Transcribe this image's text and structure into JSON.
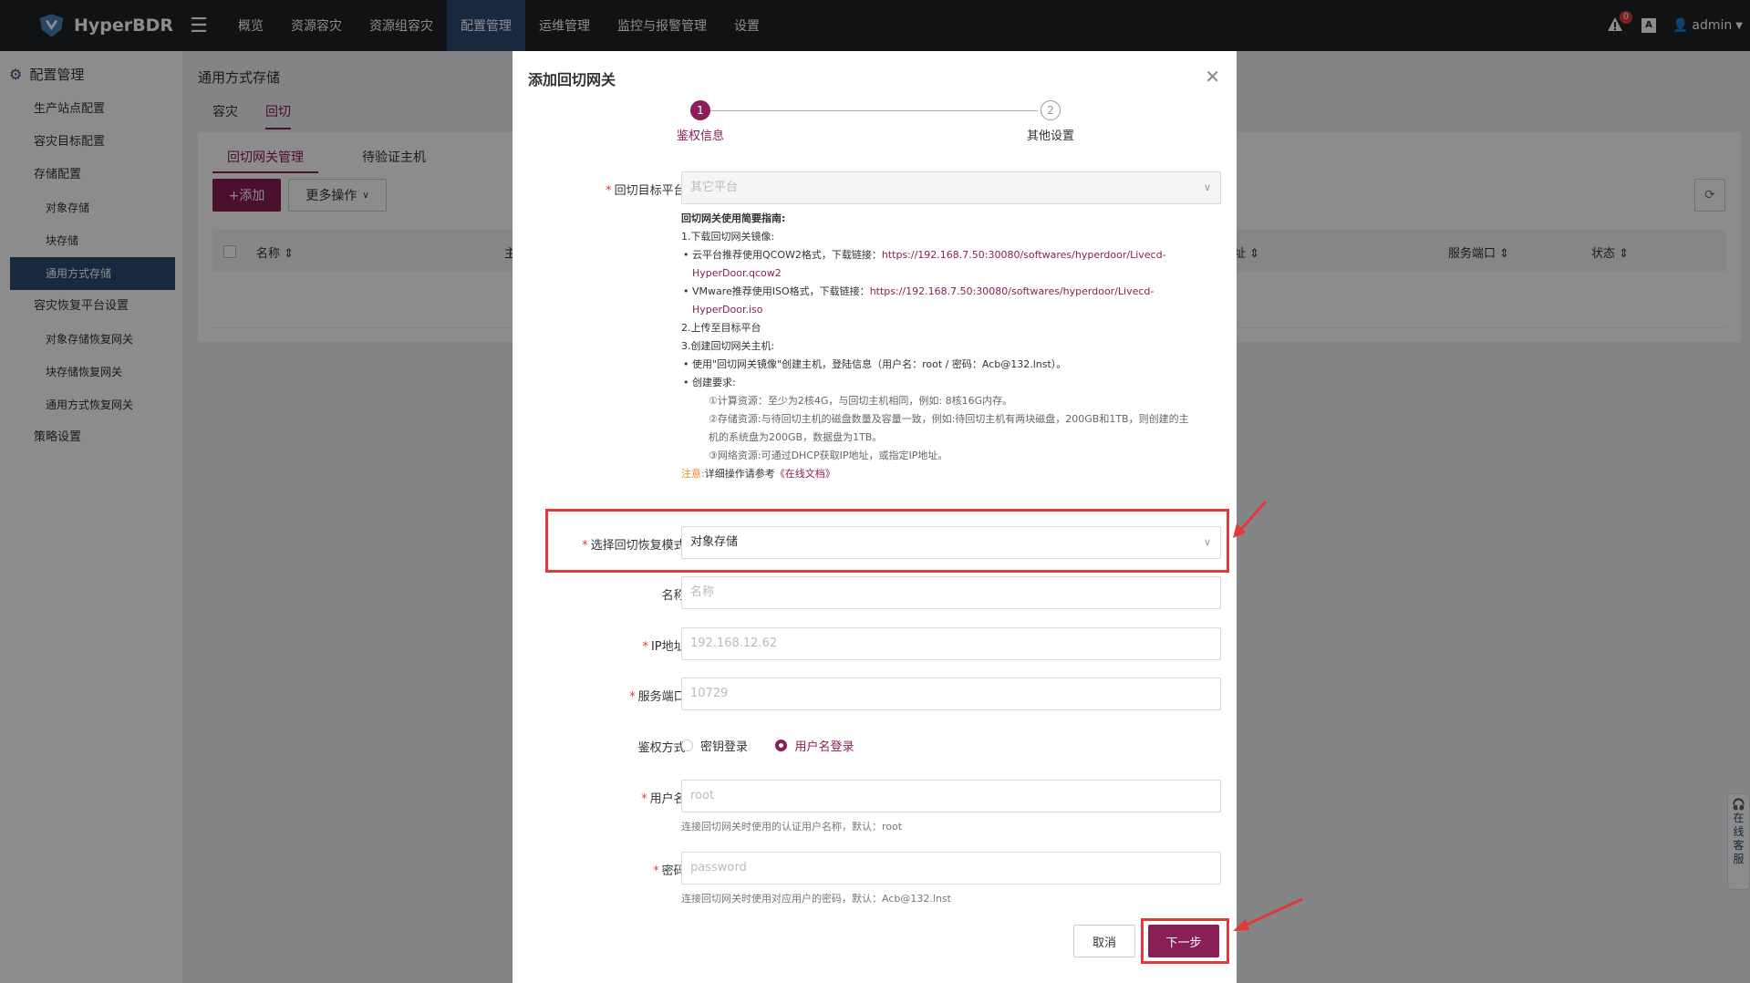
{
  "app": {
    "brand": "HyperBDR"
  },
  "topnav": {
    "items": [
      "概览",
      "资源容灾",
      "资源组容灾",
      "配置管理",
      "运维管理",
      "监控与报警管理",
      "设置"
    ],
    "active_index": 3,
    "notification_count": "0",
    "user": "admin"
  },
  "sidebar": {
    "section_title": "配置管理",
    "items": [
      {
        "label": "生产站点配置",
        "level": 1
      },
      {
        "label": "容灾目标配置",
        "level": 1
      },
      {
        "label": "存储配置",
        "level": 1
      },
      {
        "label": "对象存储",
        "level": 2
      },
      {
        "label": "块存储",
        "level": 2
      },
      {
        "label": "通用方式存储",
        "level": 2,
        "active": true
      },
      {
        "label": "容灾恢复平台设置",
        "level": 1
      },
      {
        "label": "对象存储恢复网关",
        "level": 2
      },
      {
        "label": "块存储恢复网关",
        "level": 2
      },
      {
        "label": "通用方式恢复网关",
        "level": 2
      },
      {
        "label": "策略设置",
        "level": 1
      }
    ]
  },
  "page": {
    "breadcrumb": "通用方式存储",
    "tabs": [
      "容灾",
      "回切"
    ],
    "subtabs": [
      "回切网关管理",
      "待验证主机"
    ],
    "add_button": "+添加",
    "more_button": "更多操作",
    "table_headers": [
      "名称",
      "主",
      "址",
      "服务端口",
      "状态"
    ]
  },
  "modal": {
    "title": "添加回切网关",
    "steps": [
      {
        "num": "1",
        "label": "鉴权信息"
      },
      {
        "num": "2",
        "label": "其他设置"
      }
    ],
    "platform": {
      "label": "回切目标平台:",
      "value": "其它平台"
    },
    "guide": {
      "title": "回切网关使用简要指南:",
      "s1": "1.下载回切网关镜像:",
      "s1a_text": "云平台推荐使用QCOW2格式，下载链接：",
      "s1a_link1": "https://192.168.7.50:30080/softwares/hyperdoor/Livecd-",
      "s1a_link2": "HyperDoor.qcow2",
      "s1b_text": "VMware推荐使用ISO格式，下载链接：",
      "s1b_link1": "https://192.168.7.50:30080/softwares/hyperdoor/Livecd-",
      "s1b_link2": "HyperDoor.iso",
      "s2": "2.上传至目标平台",
      "s3": "3.创建回切网关主机:",
      "s3a": "使用\"回切网关镜像\"创建主机，登陆信息（用户名：root / 密码：Acb@132.lnst）。",
      "s3b": "创建要求:",
      "r1": "①计算资源：至少为2核4G，与回切主机相同，例如: 8核16G内存。",
      "r2a": "②存储资源:与待回切主机的磁盘数量及容量一致，例如:待回切主机有两块磁盘，200GB和1TB，则创建的主",
      "r2b": "机的系统盘为200GB，数据盘为1TB。",
      "r3": "③网络资源:可通过DHCP获取IP地址，或指定IP地址。",
      "note_label": "注意:",
      "note_text": "详细操作请参考",
      "note_link": "《在线文档》"
    },
    "mode": {
      "label": "选择回切恢复模式:",
      "value": "对象存储"
    },
    "name": {
      "label": "名称:",
      "placeholder": "名称"
    },
    "ip": {
      "label": "IP地址:",
      "placeholder": "192.168.12.62"
    },
    "port": {
      "label": "服务端口:",
      "placeholder": "10729"
    },
    "auth": {
      "label": "鉴权方式:",
      "options": [
        "密钥登录",
        "用户名登录"
      ],
      "selected": 1
    },
    "username": {
      "label": "用户名:",
      "placeholder": "root",
      "hint": "连接回切网关时使用的认证用户名称，默认：root"
    },
    "password": {
      "label": "密码:",
      "placeholder": "password",
      "hint": "连接回切网关时使用对应用户的密码，默认：Acb@132.lnst"
    },
    "cancel": "取消",
    "next": "下一步"
  },
  "support": {
    "label": "在线客服"
  },
  "colors": {
    "brand": "#8a1e57",
    "nav_active": "#2c4a72",
    "highlight": "#e4393c"
  }
}
